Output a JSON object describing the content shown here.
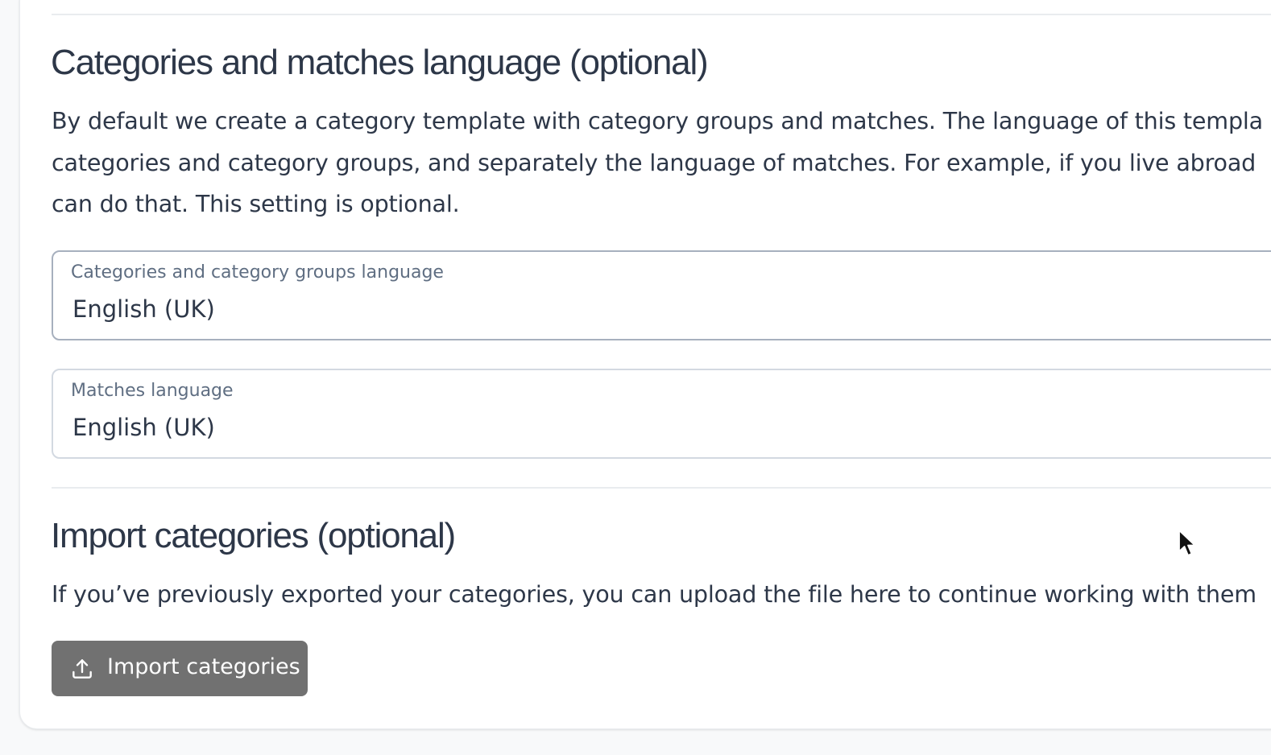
{
  "language_section": {
    "title": "Categories and matches language (optional)",
    "description_lines": [
      "By default we create a category template with category groups and matches. The language of this templa",
      "categories and category groups, and separately the language of matches. For example, if you live abroad",
      "can do that. This setting is optional."
    ],
    "category_language_field": {
      "label": "Categories and category groups language",
      "value": "English (UK)"
    },
    "matches_language_field": {
      "label": "Matches language",
      "value": "English (UK)"
    }
  },
  "import_section": {
    "title": "Import categories (optional)",
    "description": "If you’ve previously exported your categories, you can upload the file here to continue working with them",
    "button_label": "Import categories",
    "button_icon": "upload-icon"
  },
  "colors": {
    "heading": "#2d3748",
    "muted_label": "#5f6e82",
    "button_bg": "#717171",
    "border": "#a7b0be"
  }
}
